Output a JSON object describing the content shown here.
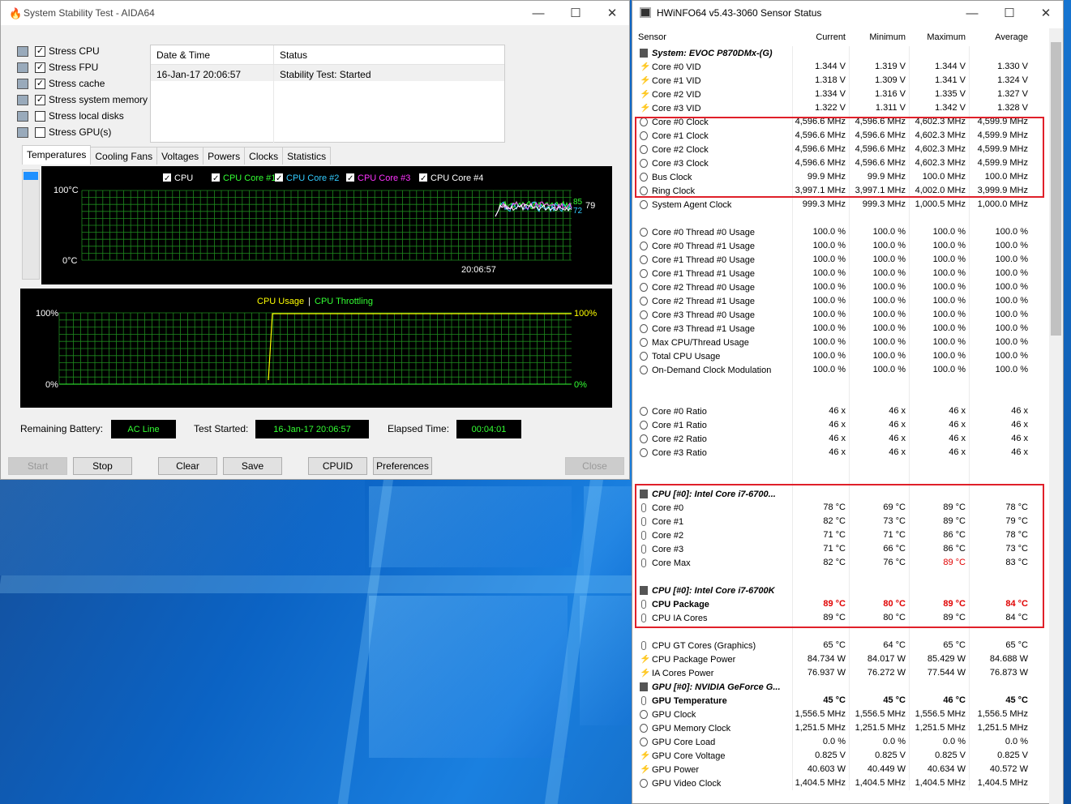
{
  "aida": {
    "title": "System Stability Test - AIDA64",
    "stress_items": [
      {
        "label": "Stress CPU",
        "checked": "✓"
      },
      {
        "label": "Stress FPU",
        "checked": "✓"
      },
      {
        "label": "Stress cache",
        "checked": "✓"
      },
      {
        "label": "Stress system memory",
        "checked": "✓"
      },
      {
        "label": "Stress local disks",
        "checked": ""
      },
      {
        "label": "Stress GPU(s)",
        "checked": ""
      }
    ],
    "status_table": {
      "col1": "Date & Time",
      "col2": "Status",
      "row": {
        "datetime": "16-Jan-17 20:06:57",
        "status": "Stability Test: Started"
      }
    },
    "tabs": [
      "Temperatures",
      "Cooling Fans",
      "Voltages",
      "Powers",
      "Clocks",
      "Statistics"
    ],
    "temp_graph": {
      "legend": [
        {
          "label": "CPU",
          "color": "#ffffff"
        },
        {
          "label": "CPU Core #1",
          "color": "#33ff33"
        },
        {
          "label": "CPU Core #2",
          "color": "#33ccff"
        },
        {
          "label": "CPU Core #3",
          "color": "#ff33ff"
        },
        {
          "label": "CPU Core #4",
          "color": "#ffffff"
        }
      ],
      "y_top": "100°C",
      "y_bottom": "0°C",
      "time": "20:06:57",
      "val_a": "85",
      "val_b": "72",
      "val_c": "79"
    },
    "usage_graph": {
      "label_usage": "CPU Usage",
      "separator": "|",
      "label_throttle": "CPU Throttling",
      "left_top": "100%",
      "left_bottom": "0%",
      "right_top": "100%",
      "right_bottom": "0%"
    },
    "bottom": {
      "battery_label": "Remaining Battery:",
      "battery_value": "AC Line",
      "started_label": "Test Started:",
      "started_value": "16-Jan-17 20:06:57",
      "elapsed_label": "Elapsed Time:",
      "elapsed_value": "00:04:01"
    },
    "buttons": {
      "start": "Start",
      "stop": "Stop",
      "clear": "Clear",
      "save": "Save",
      "cpuid": "CPUID",
      "preferences": "Preferences",
      "close": "Close"
    }
  },
  "hwinfo": {
    "title": "HWiNFO64 v5.43-3060 Sensor Status",
    "columns": [
      "Sensor",
      "Current",
      "Minimum",
      "Maximum",
      "Average"
    ],
    "rows": [
      {
        "type": "grp",
        "icon": "chip",
        "name": "System: EVOC P870DMx-(G)"
      },
      {
        "icon": "volt",
        "name": "Core #0 VID",
        "v": [
          "1.344 V",
          "1.319 V",
          "1.344 V",
          "1.330 V"
        ]
      },
      {
        "icon": "volt",
        "name": "Core #1 VID",
        "v": [
          "1.318 V",
          "1.309 V",
          "1.341 V",
          "1.324 V"
        ]
      },
      {
        "icon": "volt",
        "name": "Core #2 VID",
        "v": [
          "1.334 V",
          "1.316 V",
          "1.335 V",
          "1.327 V"
        ]
      },
      {
        "icon": "volt",
        "name": "Core #3 VID",
        "v": [
          "1.322 V",
          "1.311 V",
          "1.342 V",
          "1.328 V"
        ]
      },
      {
        "icon": "clock",
        "name": "Core #0 Clock",
        "v": [
          "4,596.6 MHz",
          "4,596.6 MHz",
          "4,602.3 MHz",
          "4,599.9 MHz"
        ]
      },
      {
        "icon": "clock",
        "name": "Core #1 Clock",
        "v": [
          "4,596.6 MHz",
          "4,596.6 MHz",
          "4,602.3 MHz",
          "4,599.9 MHz"
        ]
      },
      {
        "icon": "clock",
        "name": "Core #2 Clock",
        "v": [
          "4,596.6 MHz",
          "4,596.6 MHz",
          "4,602.3 MHz",
          "4,599.9 MHz"
        ]
      },
      {
        "icon": "clock",
        "name": "Core #3 Clock",
        "v": [
          "4,596.6 MHz",
          "4,596.6 MHz",
          "4,602.3 MHz",
          "4,599.9 MHz"
        ]
      },
      {
        "icon": "clock",
        "name": "Bus Clock",
        "v": [
          "99.9 MHz",
          "99.9 MHz",
          "100.0 MHz",
          "100.0 MHz"
        ]
      },
      {
        "icon": "clock",
        "name": "Ring Clock",
        "v": [
          "3,997.1 MHz",
          "3,997.1 MHz",
          "4,002.0 MHz",
          "3,999.9 MHz"
        ]
      },
      {
        "icon": "clock",
        "name": "System Agent Clock",
        "v": [
          "999.3 MHz",
          "999.3 MHz",
          "1,000.5 MHz",
          "1,000.0 MHz"
        ]
      },
      {
        "type": "blank"
      },
      {
        "icon": "clock",
        "name": "Core #0 Thread #0 Usage",
        "v": [
          "100.0 %",
          "100.0 %",
          "100.0 %",
          "100.0 %"
        ]
      },
      {
        "icon": "clock",
        "name": "Core #0 Thread #1 Usage",
        "v": [
          "100.0 %",
          "100.0 %",
          "100.0 %",
          "100.0 %"
        ]
      },
      {
        "icon": "clock",
        "name": "Core #1 Thread #0 Usage",
        "v": [
          "100.0 %",
          "100.0 %",
          "100.0 %",
          "100.0 %"
        ]
      },
      {
        "icon": "clock",
        "name": "Core #1 Thread #1 Usage",
        "v": [
          "100.0 %",
          "100.0 %",
          "100.0 %",
          "100.0 %"
        ]
      },
      {
        "icon": "clock",
        "name": "Core #2 Thread #0 Usage",
        "v": [
          "100.0 %",
          "100.0 %",
          "100.0 %",
          "100.0 %"
        ]
      },
      {
        "icon": "clock",
        "name": "Core #2 Thread #1 Usage",
        "v": [
          "100.0 %",
          "100.0 %",
          "100.0 %",
          "100.0 %"
        ]
      },
      {
        "icon": "clock",
        "name": "Core #3 Thread #0 Usage",
        "v": [
          "100.0 %",
          "100.0 %",
          "100.0 %",
          "100.0 %"
        ]
      },
      {
        "icon": "clock",
        "name": "Core #3 Thread #1 Usage",
        "v": [
          "100.0 %",
          "100.0 %",
          "100.0 %",
          "100.0 %"
        ]
      },
      {
        "icon": "clock",
        "name": "Max CPU/Thread Usage",
        "v": [
          "100.0 %",
          "100.0 %",
          "100.0 %",
          "100.0 %"
        ]
      },
      {
        "icon": "clock",
        "name": "Total CPU Usage",
        "v": [
          "100.0 %",
          "100.0 %",
          "100.0 %",
          "100.0 %"
        ]
      },
      {
        "icon": "clock",
        "name": "On-Demand Clock Modulation",
        "v": [
          "100.0 %",
          "100.0 %",
          "100.0 %",
          "100.0 %"
        ]
      },
      {
        "type": "blank"
      },
      {
        "type": "blank"
      },
      {
        "icon": "clock",
        "name": "Core #0 Ratio",
        "v": [
          "46 x",
          "46 x",
          "46 x",
          "46 x"
        ]
      },
      {
        "icon": "clock",
        "name": "Core #1 Ratio",
        "v": [
          "46 x",
          "46 x",
          "46 x",
          "46 x"
        ]
      },
      {
        "icon": "clock",
        "name": "Core #2 Ratio",
        "v": [
          "46 x",
          "46 x",
          "46 x",
          "46 x"
        ]
      },
      {
        "icon": "clock",
        "name": "Core #3 Ratio",
        "v": [
          "46 x",
          "46 x",
          "46 x",
          "46 x"
        ]
      },
      {
        "type": "blank"
      },
      {
        "type": "blank"
      },
      {
        "type": "grp",
        "icon": "chip",
        "name": "CPU [#0]: Intel Core i7-6700..."
      },
      {
        "icon": "temp",
        "name": "Core #0",
        "v": [
          "78 °C",
          "69 °C",
          "89 °C",
          "78 °C"
        ]
      },
      {
        "icon": "temp",
        "name": "Core #1",
        "v": [
          "82 °C",
          "73 °C",
          "89 °C",
          "79 °C"
        ]
      },
      {
        "icon": "temp",
        "name": "Core #2",
        "v": [
          "71 °C",
          "71 °C",
          "86 °C",
          "78 °C"
        ]
      },
      {
        "icon": "temp",
        "name": "Core #3",
        "v": [
          "71 °C",
          "66 °C",
          "86 °C",
          "73 °C"
        ]
      },
      {
        "icon": "temp",
        "name": "Core Max",
        "v": [
          "82 °C",
          "76 °C",
          "89 °C",
          "83 °C"
        ],
        "red": [
          false,
          false,
          true,
          false
        ]
      },
      {
        "type": "blank"
      },
      {
        "type": "grp",
        "icon": "chip",
        "name": "CPU [#0]: Intel Core i7-6700K"
      },
      {
        "icon": "temp",
        "name": "CPU Package",
        "bold": true,
        "v": [
          "89 °C",
          "80 °C",
          "89 °C",
          "84 °C"
        ],
        "red": [
          true,
          true,
          true,
          true
        ]
      },
      {
        "icon": "temp",
        "name": "CPU IA Cores",
        "v": [
          "89 °C",
          "80 °C",
          "89 °C",
          "84 °C"
        ]
      },
      {
        "type": "blank"
      },
      {
        "icon": "temp",
        "name": "CPU GT Cores (Graphics)",
        "v": [
          "65 °C",
          "64 °C",
          "65 °C",
          "65 °C"
        ]
      },
      {
        "icon": "volt",
        "name": "CPU Package Power",
        "v": [
          "84.734 W",
          "84.017 W",
          "85.429 W",
          "84.688 W"
        ]
      },
      {
        "icon": "volt",
        "name": "IA Cores Power",
        "v": [
          "76.937 W",
          "76.272 W",
          "77.544 W",
          "76.873 W"
        ]
      },
      {
        "type": "grp",
        "icon": "chip",
        "name": "GPU [#0]: NVIDIA GeForce G..."
      },
      {
        "icon": "temp",
        "name": "GPU Temperature",
        "bold": true,
        "v": [
          "45 °C",
          "45 °C",
          "46 °C",
          "45 °C"
        ]
      },
      {
        "icon": "clock",
        "name": "GPU Clock",
        "v": [
          "1,556.5 MHz",
          "1,556.5 MHz",
          "1,556.5 MHz",
          "1,556.5 MHz"
        ]
      },
      {
        "icon": "clock",
        "name": "GPU Memory Clock",
        "v": [
          "1,251.5 MHz",
          "1,251.5 MHz",
          "1,251.5 MHz",
          "1,251.5 MHz"
        ]
      },
      {
        "icon": "clock",
        "name": "GPU Core Load",
        "v": [
          "0.0 %",
          "0.0 %",
          "0.0 %",
          "0.0 %"
        ]
      },
      {
        "icon": "volt",
        "name": "GPU Core Voltage",
        "v": [
          "0.825 V",
          "0.825 V",
          "0.825 V",
          "0.825 V"
        ]
      },
      {
        "icon": "volt",
        "name": "GPU Power",
        "v": [
          "40.603 W",
          "40.449 W",
          "40.634 W",
          "40.572 W"
        ]
      },
      {
        "icon": "clock",
        "name": "GPU Video Clock",
        "v": [
          "1,404.5 MHz",
          "1,404.5 MHz",
          "1,404.5 MHz",
          "1,404.5 MHz"
        ]
      }
    ]
  }
}
